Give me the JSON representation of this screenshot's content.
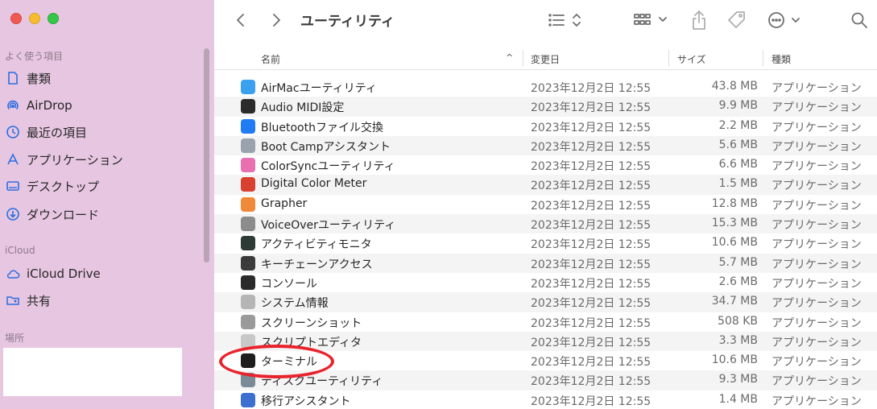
{
  "window": {
    "title": "ユーティリティ"
  },
  "sidebar": {
    "favorites_title": "よく使う項目",
    "favorites": [
      {
        "label": "書類",
        "icon": "document-icon"
      },
      {
        "label": "AirDrop",
        "icon": "airdrop-icon"
      },
      {
        "label": "最近の項目",
        "icon": "clock-icon"
      },
      {
        "label": "アプリケーション",
        "icon": "applications-icon"
      },
      {
        "label": "デスクトップ",
        "icon": "desktop-icon"
      },
      {
        "label": "ダウンロード",
        "icon": "download-icon"
      }
    ],
    "icloud_title": "iCloud",
    "icloud": [
      {
        "label": "iCloud Drive",
        "icon": "cloud-icon"
      },
      {
        "label": "共有",
        "icon": "shared-folder-icon"
      }
    ],
    "places_title": "場所"
  },
  "columns": {
    "name": "名前",
    "date": "変更日",
    "size": "サイズ",
    "kind": "種類"
  },
  "files": [
    {
      "name": "AirMacユーティリティ",
      "date": "2023年12月2日 12:55",
      "size": "43.8 MB",
      "kind": "アプリケーション",
      "color": "#3aa0f0"
    },
    {
      "name": "Audio MIDI設定",
      "date": "2023年12月2日 12:55",
      "size": "9.9 MB",
      "kind": "アプリケーション",
      "color": "#2b2b2b"
    },
    {
      "name": "Bluetoothファイル交換",
      "date": "2023年12月2日 12:55",
      "size": "2.2 MB",
      "kind": "アプリケーション",
      "color": "#1f7cf2"
    },
    {
      "name": "Boot Campアシスタント",
      "date": "2023年12月2日 12:55",
      "size": "5.6 MB",
      "kind": "アプリケーション",
      "color": "#9aa3ad"
    },
    {
      "name": "ColorSyncユーティリティ",
      "date": "2023年12月2日 12:55",
      "size": "6.6 MB",
      "kind": "アプリケーション",
      "color": "#e86fb0"
    },
    {
      "name": "Digital Color Meter",
      "date": "2023年12月2日 12:55",
      "size": "1.5 MB",
      "kind": "アプリケーション",
      "color": "#d8402f"
    },
    {
      "name": "Grapher",
      "date": "2023年12月2日 12:55",
      "size": "12.8 MB",
      "kind": "アプリケーション",
      "color": "#f08a3a"
    },
    {
      "name": "VoiceOverユーティリティ",
      "date": "2023年12月2日 12:55",
      "size": "15.3 MB",
      "kind": "アプリケーション",
      "color": "#8c8c8c"
    },
    {
      "name": "アクティビティモニタ",
      "date": "2023年12月2日 12:55",
      "size": "10.6 MB",
      "kind": "アプリケーション",
      "color": "#2e3a35"
    },
    {
      "name": "キーチェーンアクセス",
      "date": "2023年12月2日 12:55",
      "size": "5.7 MB",
      "kind": "アプリケーション",
      "color": "#3b3b3b"
    },
    {
      "name": "コンソール",
      "date": "2023年12月2日 12:55",
      "size": "2.6 MB",
      "kind": "アプリケーション",
      "color": "#2a2a2a"
    },
    {
      "name": "システム情報",
      "date": "2023年12月2日 12:55",
      "size": "34.7 MB",
      "kind": "アプリケーション",
      "color": "#b5b5b5"
    },
    {
      "name": "スクリーンショット",
      "date": "2023年12月2日 12:55",
      "size": "508 KB",
      "kind": "アプリケーション",
      "color": "#9a9a9a"
    },
    {
      "name": "スクリプトエディタ",
      "date": "2023年12月2日 12:55",
      "size": "3.3 MB",
      "kind": "アプリケーション",
      "color": "#c8c8c8"
    },
    {
      "name": "ターミナル",
      "date": "2023年12月2日 12:55",
      "size": "10.6 MB",
      "kind": "アプリケーション",
      "color": "#1d1d1d"
    },
    {
      "name": "ディスクユーティリティ",
      "date": "2023年12月2日 12:55",
      "size": "9.3 MB",
      "kind": "アプリケーション",
      "color": "#7a8a96"
    },
    {
      "name": "移行アシスタント",
      "date": "2023年12月2日 12:55",
      "size": "1.4 MB",
      "kind": "アプリケーション",
      "color": "#3d6fd1"
    }
  ],
  "annotation": {
    "color": "#e8232b",
    "target": "ターミナル"
  }
}
